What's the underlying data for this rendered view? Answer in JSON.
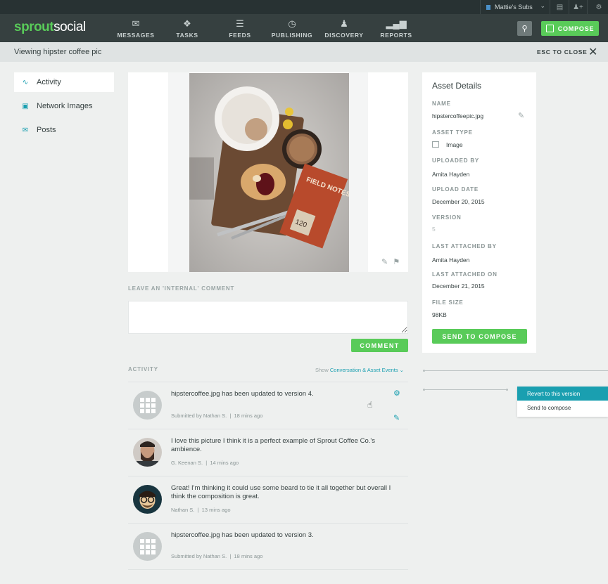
{
  "topbar": {
    "account_label": "Mattie's Subs",
    "icons": [
      "pages-icon",
      "add-user-icon",
      "settings-icon"
    ]
  },
  "nav": {
    "logo_part1": "sprout",
    "logo_part2": "social",
    "items": [
      {
        "label": "MESSAGES",
        "icon": "envelope-icon"
      },
      {
        "label": "TASKS",
        "icon": "pin-icon"
      },
      {
        "label": "FEEDS",
        "icon": "feeds-icon"
      },
      {
        "label": "PUBLISHING",
        "icon": "clock-icon"
      },
      {
        "label": "DISCOVERY",
        "icon": "person-icon"
      },
      {
        "label": "REPORTS",
        "icon": "bar-chart-icon"
      }
    ],
    "compose_label": "COMPOSE"
  },
  "subbar": {
    "title": "Viewing hipster coffee pic",
    "close_label": "ESC TO CLOSE"
  },
  "sidebar": {
    "items": [
      {
        "label": "Activity",
        "icon": "activity-icon",
        "active": true
      },
      {
        "label": "Network Images",
        "icon": "image-icon",
        "active": false
      },
      {
        "label": "Posts",
        "icon": "envelope-icon",
        "active": false
      }
    ]
  },
  "image_caption_text": {
    "notebook_title": "FIELD NOTES",
    "notebook_number": "120"
  },
  "comment": {
    "label": "LEAVE AN 'INTERNAL' COMMENT",
    "placeholder": "",
    "button": "COMMENT"
  },
  "activity": {
    "label": "ACTIVITY",
    "filter_prefix": "Show",
    "filter_value": "Conversation & Asset Events",
    "items": [
      {
        "text": "hipstercoffee.jpg has been updated to version 4.",
        "author": "Submitted by Nathan S.",
        "time": "18 mins ago",
        "avatar": "grid"
      },
      {
        "text": "I love this picture I think it is a perfect example of Sprout Coffee Co.'s ambience.",
        "author": "G. Keenan S.",
        "time": "14 mins ago",
        "avatar": "bearded-man"
      },
      {
        "text": "Great! I'm thinking it could use some beard to tie it all together but overall I think the composition is great.",
        "author": "Nathan S.",
        "time": "13 mins ago",
        "avatar": "glasses-man"
      },
      {
        "text": "hipstercoffee.jpg has been updated to version 3.",
        "author": "Submitted by Nathan S.",
        "time": "18 mins ago",
        "avatar": "grid"
      }
    ]
  },
  "details": {
    "title": "Asset Details",
    "name_label": "NAME",
    "name_value": "hipstercoffeepic.jpg",
    "type_label": "ASSET TYPE",
    "type_value": "Image",
    "uploaded_by_label": "UPLOADED BY",
    "uploaded_by_value": "Amita Hayden",
    "upload_date_label": "UPLOAD DATE",
    "upload_date_value": "December 20, 2015",
    "version_label": "VERSION",
    "version_value": "5",
    "last_attached_by_label": "LAST ATTACHED BY",
    "last_attached_by_value": "Amita Hayden",
    "last_attached_on_label": "LAST ATTACHED ON",
    "last_attached_on_value": "December 21, 2015",
    "file_size_label": "FILE SIZE",
    "file_size_value": "98KB",
    "send_button": "SEND TO COMPOSE"
  },
  "popover": {
    "option1": "Revert to this version",
    "option2": "Send to compose"
  },
  "colors": {
    "brand_green": "#59cb59",
    "accent_teal": "#1a9fb0",
    "nav_dark": "#364040"
  }
}
